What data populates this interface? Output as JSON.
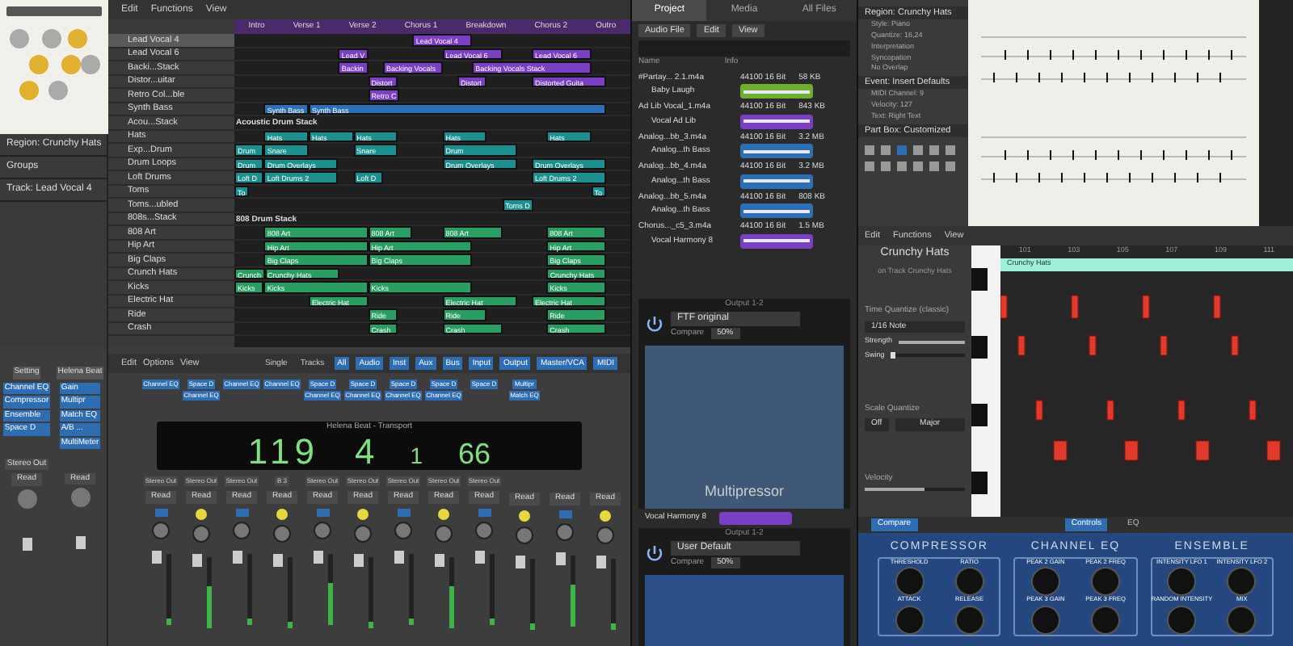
{
  "inspector": {
    "region": "Region: Crunchy Hats",
    "groups": "Groups",
    "track": "Track: Lead Vocal 4"
  },
  "left_strips": [
    {
      "name": "Setting",
      "inserts": [
        "Channel EQ",
        "Compressor",
        "Ensemble",
        "Space D"
      ],
      "output": "Stereo Out",
      "automation": "Read"
    },
    {
      "name": "Helena Beat",
      "inserts": [
        "Gain",
        "Multipr",
        "Match EQ",
        "A/B ...",
        "MultiMeter"
      ],
      "automation": "Read"
    }
  ],
  "tracks_toolbar": [
    "Edit",
    "Functions",
    "View"
  ],
  "markers": [
    "Intro",
    "Verse 1",
    "Verse 2",
    "Chorus 1",
    "Breakdown",
    "Chorus 2",
    "Outro"
  ],
  "tracks": [
    {
      "name": "Lead Vocal 4",
      "kind": "track",
      "selected": true,
      "color": "#7b3fc4",
      "regions": [
        "Lead Vocal 4"
      ]
    },
    {
      "name": "Lead Vocal 6",
      "kind": "track",
      "selected": false,
      "color": "#7b3fc4",
      "regions": [
        "Lead V",
        "Lead Vocal 6",
        "Lead Vocal 6"
      ]
    },
    {
      "name": "Backi...Stack",
      "kind": "track",
      "selected": false,
      "color": "#7b3fc4",
      "regions": [
        "Backin",
        "Backing Vocals",
        "Backing Vocals Stack"
      ]
    },
    {
      "name": "Distor...uitar",
      "kind": "track",
      "selected": false,
      "color": "#7b3fc4",
      "regions": [
        "Distort",
        "Distort",
        "Distorted Guita"
      ]
    },
    {
      "name": "Retro Col...ble",
      "kind": "track",
      "selected": false,
      "color": "#7b3fc4",
      "regions": [
        "Retro C"
      ]
    },
    {
      "name": "Synth Bass",
      "kind": "track",
      "selected": false,
      "color": "#2c6fb5",
      "regions": [
        "Synth Bass",
        "Synth Bass"
      ]
    },
    {
      "name": "Acou...Stack",
      "kind": "folder",
      "selected": false,
      "regions": [
        "Acoustic Drum Stack"
      ]
    },
    {
      "name": "Hats",
      "kind": "track",
      "selected": false,
      "color": "#1d8f8f",
      "regions": [
        "Hats",
        "Hats",
        "Hats",
        "Hats",
        "Hats"
      ]
    },
    {
      "name": "Exp...Drum",
      "kind": "track",
      "selected": false,
      "color": "#1d8f8f",
      "regions": [
        "Drum",
        "Snare",
        "Snare",
        "Drum"
      ]
    },
    {
      "name": "Drum Loops",
      "kind": "track",
      "selected": false,
      "color": "#1d8f8f",
      "regions": [
        "Drum",
        "Drum Overlays",
        "Drum Overlays",
        "Drum Overlays"
      ]
    },
    {
      "name": "Loft Drums",
      "kind": "track",
      "selected": false,
      "color": "#1d8f8f",
      "regions": [
        "Loft D",
        "Loft Drums 2",
        "Loft D",
        "Loft Drums 2"
      ]
    },
    {
      "name": "Toms",
      "kind": "track",
      "selected": false,
      "color": "#1d8f8f",
      "regions": [
        "To",
        "To"
      ]
    },
    {
      "name": "Toms...ubled",
      "kind": "track",
      "selected": false,
      "color": "#1d8f8f",
      "regions": [
        "Toms D"
      ]
    },
    {
      "name": "808s...Stack",
      "kind": "folder",
      "selected": false,
      "regions": [
        "808 Drum Stack"
      ]
    },
    {
      "name": "808 Art",
      "kind": "track",
      "selected": false,
      "color": "#2a9d62",
      "regions": [
        "808 Art",
        "808 Art",
        "808 Art",
        "808 Art"
      ]
    },
    {
      "name": "Hip Art",
      "kind": "track",
      "selected": false,
      "color": "#2a9d62",
      "regions": [
        "Hip Art",
        "Hip Art",
        "Hip Art"
      ]
    },
    {
      "name": "Big Claps",
      "kind": "track",
      "selected": false,
      "color": "#2a9d62",
      "regions": [
        "Big Claps",
        "Big Claps",
        "Big Claps"
      ]
    },
    {
      "name": "Crunch Hats",
      "kind": "track",
      "selected": false,
      "color": "#2a9d62",
      "regions": [
        "Crunch",
        "Crunchy Hats",
        "Crunchy Hats"
      ]
    },
    {
      "name": "Kicks",
      "kind": "track",
      "selected": false,
      "color": "#2a9d62",
      "regions": [
        "Kicks",
        "Kicks",
        "Kicks",
        "Kicks"
      ]
    },
    {
      "name": "Electric Hat",
      "kind": "track",
      "selected": false,
      "color": "#2a9d62",
      "regions": [
        "Electric Hat",
        "Electric Hat",
        "Electric Hat"
      ]
    },
    {
      "name": "Ride",
      "kind": "track",
      "selected": false,
      "color": "#2a9d62",
      "regions": [
        "Ride",
        "Ride",
        "Ride"
      ]
    },
    {
      "name": "Crash",
      "kind": "track",
      "selected": false,
      "color": "#2a9d62",
      "regions": [
        "Crash",
        "Crash",
        "Crash"
      ]
    }
  ],
  "mixer_toolbar": [
    "Edit",
    "Options",
    "View"
  ],
  "mixer_filters": [
    {
      "label": "Single",
      "selected": false
    },
    {
      "label": "Tracks",
      "selected": false
    },
    {
      "label": "All",
      "selected": true
    },
    {
      "label": "Audio",
      "selected": true
    },
    {
      "label": "Inst",
      "selected": true
    },
    {
      "label": "Aux",
      "selected": true
    },
    {
      "label": "Bus",
      "selected": true
    },
    {
      "label": "Input",
      "selected": true
    },
    {
      "label": "Output",
      "selected": true
    },
    {
      "label": "Master/VCA",
      "selected": true
    },
    {
      "label": "MIDI",
      "selected": true
    }
  ],
  "channels": [
    {
      "inserts": [
        "Channel EQ"
      ],
      "output": "Stereo Out",
      "automation": "Read"
    },
    {
      "inserts": [
        "Space D",
        "Channel EQ"
      ],
      "output": "Stereo Out",
      "automation": "Read"
    },
    {
      "inserts": [
        "Channel EQ"
      ],
      "output": "Stereo Out",
      "automation": "Read"
    },
    {
      "inserts": [
        "Channel EQ"
      ],
      "output": "B 3",
      "automation": "Read"
    },
    {
      "inserts": [
        "Space D",
        "Channel EQ"
      ],
      "output": "Stereo Out",
      "automation": "Read"
    },
    {
      "inserts": [
        "Space D",
        "Channel EQ"
      ],
      "output": "Stereo Out",
      "automation": "Read"
    },
    {
      "inserts": [
        "Space D",
        "Channel EQ"
      ],
      "output": "Stereo Out",
      "automation": "Read"
    },
    {
      "inserts": [
        "Space D",
        "Channel EQ"
      ],
      "output": "Stereo Out",
      "automation": "Read"
    },
    {
      "inserts": [
        "Space D"
      ],
      "output": "Stereo Out",
      "automation": "Read"
    },
    {
      "inserts": [
        "Multipr",
        "Match EQ"
      ],
      "automation": "Read"
    },
    {
      "automation": "Read"
    },
    {
      "automation": "Read"
    }
  ],
  "transport": {
    "title": "Helena Beat - Transport",
    "bar": "119",
    "beat": "4",
    "division": "1",
    "tick": "66"
  },
  "browser": {
    "tabs": [
      {
        "label": "Project",
        "selected": true
      },
      {
        "label": "Media",
        "selected": false
      },
      {
        "label": "All Files",
        "selected": false
      }
    ],
    "menus": [
      "Audio File",
      "Edit",
      "View"
    ],
    "columns": [
      "Name",
      "Info"
    ],
    "files": [
      {
        "file": "#Partay... 2.1.m4a",
        "info": "44100 16 Bit",
        "size": "58 KB",
        "region": "Baby Laugh",
        "color": "#6fae2c"
      },
      {
        "file": "Ad Lib Vocal_1.m4a",
        "info": "44100 16 Bit",
        "size": "843 KB",
        "region": "Vocal Ad Lib",
        "color": "#7b3fc4"
      },
      {
        "file": "Analog...bb_3.m4a",
        "info": "44100 16 Bit",
        "size": "3.2 MB",
        "region": "Analog...th Bass",
        "color": "#2c6fb5"
      },
      {
        "file": "Analog...bb_4.m4a",
        "info": "44100 16 Bit",
        "size": "3.2 MB",
        "region": "Analog...th Bass",
        "color": "#2c6fb5"
      },
      {
        "file": "Analog...bb_5.m4a",
        "info": "44100 16 Bit",
        "size": "808 KB",
        "region": "Analog...th Bass",
        "color": "#2c6fb5"
      },
      {
        "file": "Chorus..._c5_3.m4a",
        "info": "44100 16 Bit",
        "size": "1.5 MB",
        "region": "Vocal Harmony 8",
        "color": "#7b3fc4"
      }
    ]
  },
  "multipressor": {
    "window": "Output 1-2",
    "preset": "FTF original",
    "compare": "Compare",
    "mix": "50%",
    "name": "Multipressor"
  },
  "vocal_row": "Vocal Harmony 8",
  "output_plugin": {
    "window": "Output 1-2",
    "preset": "User Default",
    "compare": "Compare",
    "mix": "50%"
  },
  "score_inspector": {
    "sections": [
      {
        "title": "Region: Crunchy Hats",
        "fields": [
          "Style: Piano",
          "Quantize: 16,24",
          "Interpretation",
          "Syncopation",
          "No Overlap"
        ]
      },
      {
        "title": "Event: Insert Defaults",
        "fields": [
          "MIDI Channel: 9",
          "Velocity: 127",
          "Text: Right Text"
        ]
      },
      {
        "title": "Part Box: Customized"
      }
    ]
  },
  "piano_roll": {
    "menus": [
      "Edit",
      "Functions",
      "View"
    ],
    "region": "Crunchy Hats",
    "track": "on Track Crunchy Hats",
    "quantize_title": "Time Quantize (classic)",
    "quantize": "1/16 Note",
    "strength": {
      "label": "Strength",
      "level": 1
    },
    "swing": {
      "label": "Swing",
      "level": 0
    },
    "scale_title": "Scale Quantize",
    "scale_off": "Off",
    "scale_mode": "Major",
    "velocity": {
      "label": "Velocity",
      "level": 0.6
    },
    "ruler": [
      "101",
      "103",
      "105",
      "107",
      "109",
      "111"
    ],
    "region_bar": "Crunchy Hats"
  },
  "plugin": {
    "compare": "Compare",
    "tabs": [
      {
        "label": "Controls",
        "selected": true
      },
      {
        "label": "EQ",
        "selected": false
      }
    ],
    "sections": [
      {
        "title": "COMPRESSOR",
        "knobs": [
          "THRESHOLD",
          "RATIO",
          "ATTACK",
          "RELEASE"
        ]
      },
      {
        "title": "CHANNEL EQ",
        "knobs": [
          "PEAK 2 GAIN",
          "PEAK 2 FREQ",
          "PEAK 3 GAIN",
          "PEAK 3 FREQ"
        ]
      },
      {
        "title": "ENSEMBLE",
        "knobs": [
          "INTENSITY LFO 1",
          "INTENSITY LFO 2",
          "RANDOM INTENSITY",
          "MIX"
        ]
      }
    ]
  }
}
